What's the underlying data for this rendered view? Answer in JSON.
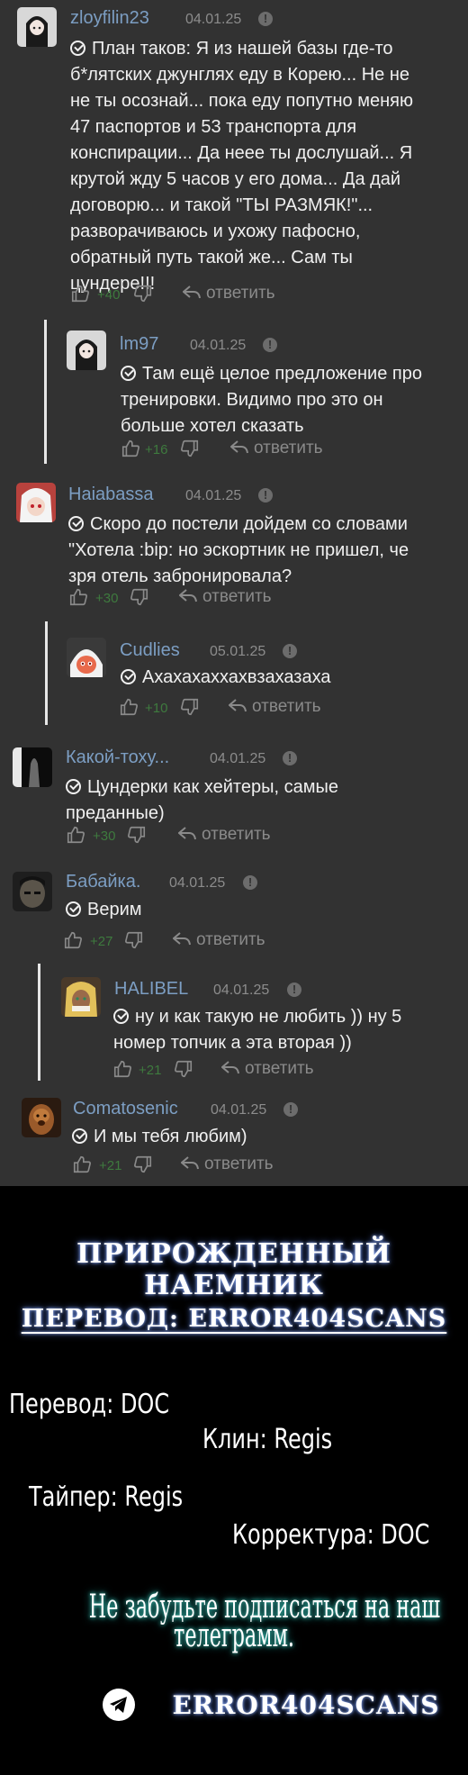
{
  "comments": [
    {
      "user": "zloyfilin23",
      "date": "04.01.25",
      "text": "План таков: Я из нашей базы где-то\nб*лятских джунглях еду в Корею... Не не\nне ты осознай... пока еду попутно меняю\n47 паспортов и 53 транспорта для\nконспирации... Да неее ты дослушай... Я\nкрутой жду 5 часов у его дома... Да дай\nдоговорю... и такой \"ТЫ РАЗМЯК!\"...\nразворачиваюсь и ухожу пафосно,\nобратный путь такой же... Сам ты\nцундере!!!",
      "score": "+40",
      "reply": "ответить",
      "avatar": "dark-haired-girl"
    },
    {
      "user": "lm97",
      "date": "04.01.25",
      "text": "Там ещё целое предложение про\nтренировки. Видимо про это он\nбольше хотел сказать",
      "score": "+16",
      "reply": "ответить",
      "avatar": "dark-haired-girl"
    },
    {
      "user": "Haiabassa",
      "date": "04.01.25",
      "text": "Скоро до постели дойдем со словами\n\"Хотела :bip: но эскортник не пришел, че\nзря отель забронировала?",
      "score": "+30",
      "reply": "ответить",
      "avatar": "white-haired-anime-girl"
    },
    {
      "user": "Cudlies",
      "date": "05.01.25",
      "text": "Ахахахаххахвзахазаха",
      "score": "+10",
      "reply": "ответить",
      "avatar": "anime-girl-red-eyes"
    },
    {
      "user": "Какой-тоху...",
      "date": "04.01.25",
      "text": "Цундерки как хейтеры, самые\nпреданные)",
      "score": "+30",
      "reply": "ответить",
      "avatar": "dark-figure"
    },
    {
      "user": "Бабайка.",
      "date": "04.01.25",
      "text": "Верим",
      "score": "+27",
      "reply": "ответить",
      "avatar": "dark-face"
    },
    {
      "user": "HALIBEL",
      "date": "04.01.25",
      "text": "ну и как такую не любить )) ну 5\nномер топчик а эта вторая ))",
      "score": "+21",
      "reply": "ответить",
      "avatar": "blonde-character"
    },
    {
      "user": "Comatosenic",
      "date": "04.01.25",
      "text": "И мы тебя любим)",
      "score": "+21",
      "reply": "ответить",
      "avatar": "dog-portrait"
    }
  ],
  "credits": {
    "title": "ПРИРОЖДЕННЫЙ НАЕМНИК",
    "team": "ПЕРЕВОД: ERROR404SCANS",
    "translator": "Перевод: DOC",
    "cleaner": "Клин: Regis",
    "typer": "Тайпер: Regis",
    "proofreader": "Корректура: DOC",
    "reminder_line1": "Не забудьте подписаться на наш",
    "reminder_line2": "телеграмм.",
    "telegram": "ERROR404SCANS"
  },
  "colors": {
    "background": "#323232",
    "username": "#7c9ec3",
    "score": "#3e7a3e",
    "footer": "#000000"
  }
}
